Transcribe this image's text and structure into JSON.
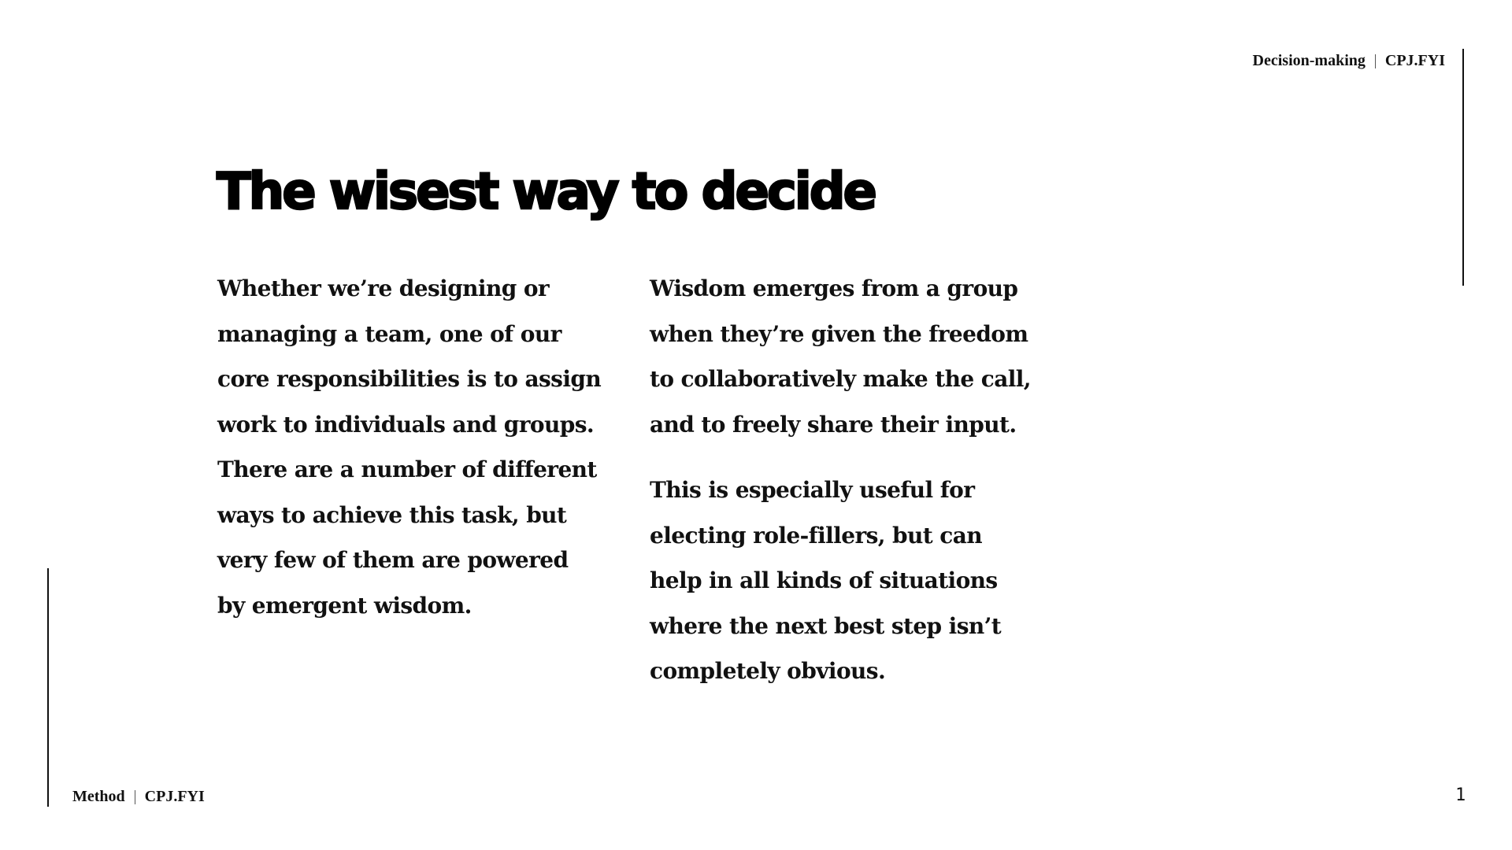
{
  "header": {
    "section": "Decision-making",
    "site": "CPJ.FYI"
  },
  "title": "The wisest way to decide",
  "body": {
    "left_column": {
      "paragraphs": [
        {
          "lines": [
            "Whether we’re designing or",
            "managing a team, one of our",
            "core responsibilities is to assign",
            "work to individuals and groups.",
            "There are a number of different",
            "ways to achieve this task, but",
            "very few of them are powered",
            "by emergent wisdom."
          ]
        }
      ]
    },
    "right_column": {
      "paragraphs": [
        {
          "lines": [
            "Wisdom emerges from a group",
            "when they’re given the freedom",
            "to collaboratively make the call,",
            "and to freely share their input."
          ]
        },
        {
          "lines": [
            "This is especially useful for",
            "electing role-fillers, but can",
            "help in all kinds of situations",
            "where the next best step isn’t",
            "completely obvious."
          ]
        }
      ]
    }
  },
  "footer": {
    "section": "Method",
    "site": "CPJ.FYI",
    "page_number": "1"
  }
}
